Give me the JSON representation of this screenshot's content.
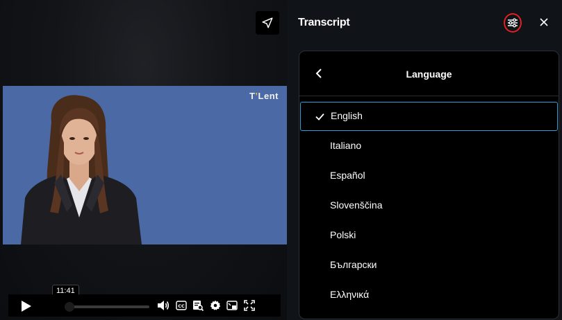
{
  "player": {
    "brand": {
      "prefix": "T",
      "accent": "’",
      "suffix": "Lent"
    },
    "time_tooltip": "11:41",
    "progress": 0,
    "controls": [
      {
        "name": "volume-icon"
      },
      {
        "name": "closed-captions-icon"
      },
      {
        "name": "transcript-search-icon"
      },
      {
        "name": "settings-gear-icon"
      },
      {
        "name": "picture-in-picture-icon"
      },
      {
        "name": "fullscreen-icon"
      }
    ]
  },
  "transcript": {
    "title": "Transcript",
    "language_menu": {
      "title": "Language",
      "selected": "English",
      "options": [
        "English",
        "Italiano",
        "Español",
        "Slovenščina",
        "Polski",
        "Български",
        "Ελληνικά"
      ]
    }
  },
  "colors": {
    "accent_blue": "#2aa3db",
    "highlight_red": "#e32020",
    "video_bg": "#4b69a4"
  }
}
